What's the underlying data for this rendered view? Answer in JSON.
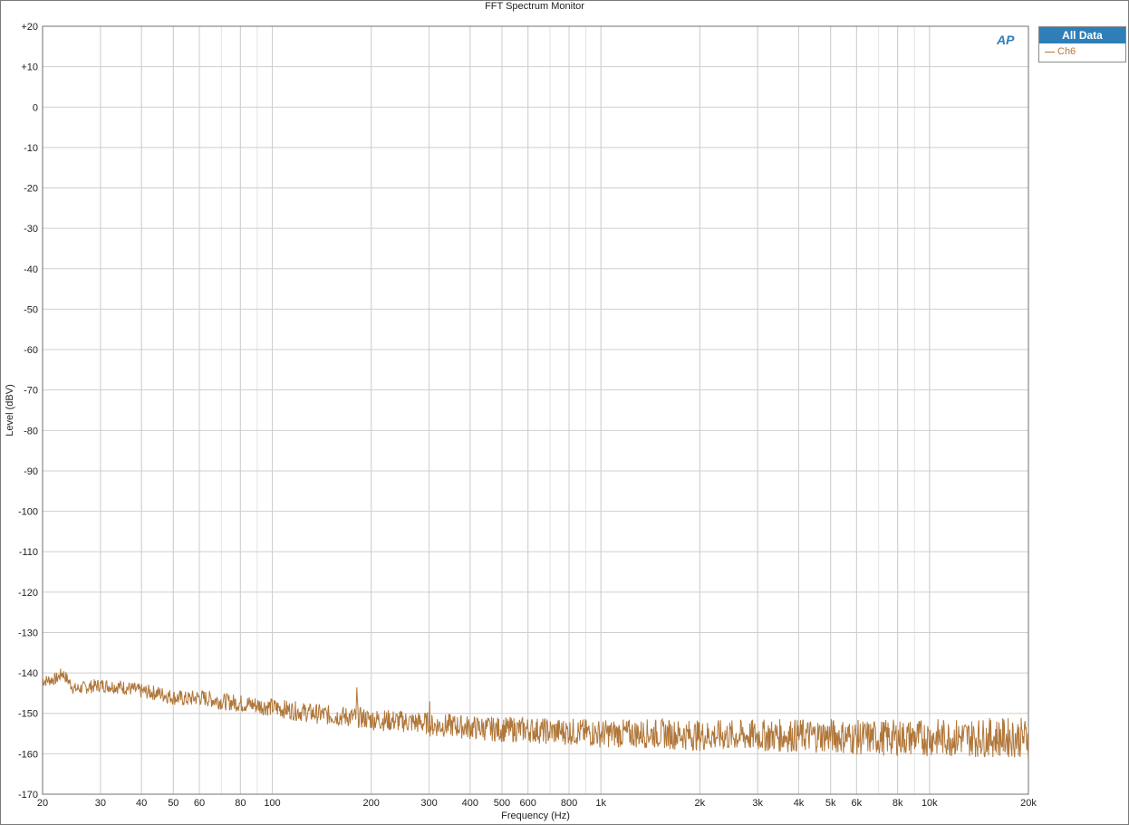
{
  "window": {
    "title": "FFT Spectrum Monitor"
  },
  "legend": {
    "header": "All Data",
    "items": [
      {
        "name": "Ch6",
        "color": "#b0773a"
      }
    ]
  },
  "logo": {
    "text": "AP"
  },
  "chart_data": {
    "type": "line",
    "title": "FFT Spectrum Monitor",
    "xlabel": "Frequency (Hz)",
    "ylabel": "Level (dBV)",
    "x_scale": "log",
    "xlim": [
      20,
      20000
    ],
    "ylim": [
      -170,
      20
    ],
    "grid": true,
    "legend_position": "right",
    "x_ticks": [
      {
        "v": 20,
        "label": "20"
      },
      {
        "v": 30,
        "label": "30"
      },
      {
        "v": 40,
        "label": "40"
      },
      {
        "v": 50,
        "label": "50"
      },
      {
        "v": 60,
        "label": "60"
      },
      {
        "v": 80,
        "label": "80"
      },
      {
        "v": 100,
        "label": "100"
      },
      {
        "v": 200,
        "label": "200"
      },
      {
        "v": 300,
        "label": "300"
      },
      {
        "v": 400,
        "label": "400"
      },
      {
        "v": 500,
        "label": "500"
      },
      {
        "v": 600,
        "label": "600"
      },
      {
        "v": 800,
        "label": "800"
      },
      {
        "v": 1000,
        "label": "1k"
      },
      {
        "v": 2000,
        "label": "2k"
      },
      {
        "v": 3000,
        "label": "3k"
      },
      {
        "v": 4000,
        "label": "4k"
      },
      {
        "v": 5000,
        "label": "5k"
      },
      {
        "v": 6000,
        "label": "6k"
      },
      {
        "v": 8000,
        "label": "8k"
      },
      {
        "v": 10000,
        "label": "10k"
      },
      {
        "v": 20000,
        "label": "20k"
      }
    ],
    "y_ticks": [
      {
        "v": 20,
        "label": "+20"
      },
      {
        "v": 10,
        "label": "+10"
      },
      {
        "v": 0,
        "label": "0"
      },
      {
        "v": -10,
        "label": "-10"
      },
      {
        "v": -20,
        "label": "-20"
      },
      {
        "v": -30,
        "label": "-30"
      },
      {
        "v": -40,
        "label": "-40"
      },
      {
        "v": -50,
        "label": "-50"
      },
      {
        "v": -60,
        "label": "-60"
      },
      {
        "v": -70,
        "label": "-70"
      },
      {
        "v": -80,
        "label": "-80"
      },
      {
        "v": -90,
        "label": "-90"
      },
      {
        "v": -100,
        "label": "-100"
      },
      {
        "v": -110,
        "label": "-110"
      },
      {
        "v": -120,
        "label": "-120"
      },
      {
        "v": -130,
        "label": "-130"
      },
      {
        "v": -140,
        "label": "-140"
      },
      {
        "v": -150,
        "label": "-150"
      },
      {
        "v": -160,
        "label": "-160"
      },
      {
        "v": -170,
        "label": "-170"
      }
    ],
    "series": [
      {
        "name": "Ch6",
        "color": "#b0773a",
        "x": [
          20,
          22,
          23,
          25,
          30,
          35,
          40,
          45,
          50,
          55,
          60,
          70,
          80,
          90,
          100,
          120,
          150,
          180,
          181,
          182,
          200,
          250,
          300,
          301,
          302,
          350,
          400,
          500,
          600,
          700,
          800,
          1000,
          1500,
          2000,
          3000,
          4000,
          5000,
          6000,
          8000,
          10000,
          15000,
          20000
        ],
        "y": [
          -142,
          -141.5,
          -140,
          -144,
          -143,
          -143.5,
          -144.5,
          -145,
          -146,
          -146.5,
          -146,
          -147,
          -147.5,
          -148,
          -148.5,
          -149.5,
          -150.5,
          -151,
          -143.5,
          -151,
          -151.5,
          -152,
          -152.5,
          -147,
          -153,
          -153,
          -153.5,
          -154,
          -154,
          -154.5,
          -154.5,
          -155,
          -155,
          -155.5,
          -155.5,
          -155.5,
          -155.5,
          -156,
          -156,
          -156,
          -156,
          -156
        ]
      }
    ]
  }
}
